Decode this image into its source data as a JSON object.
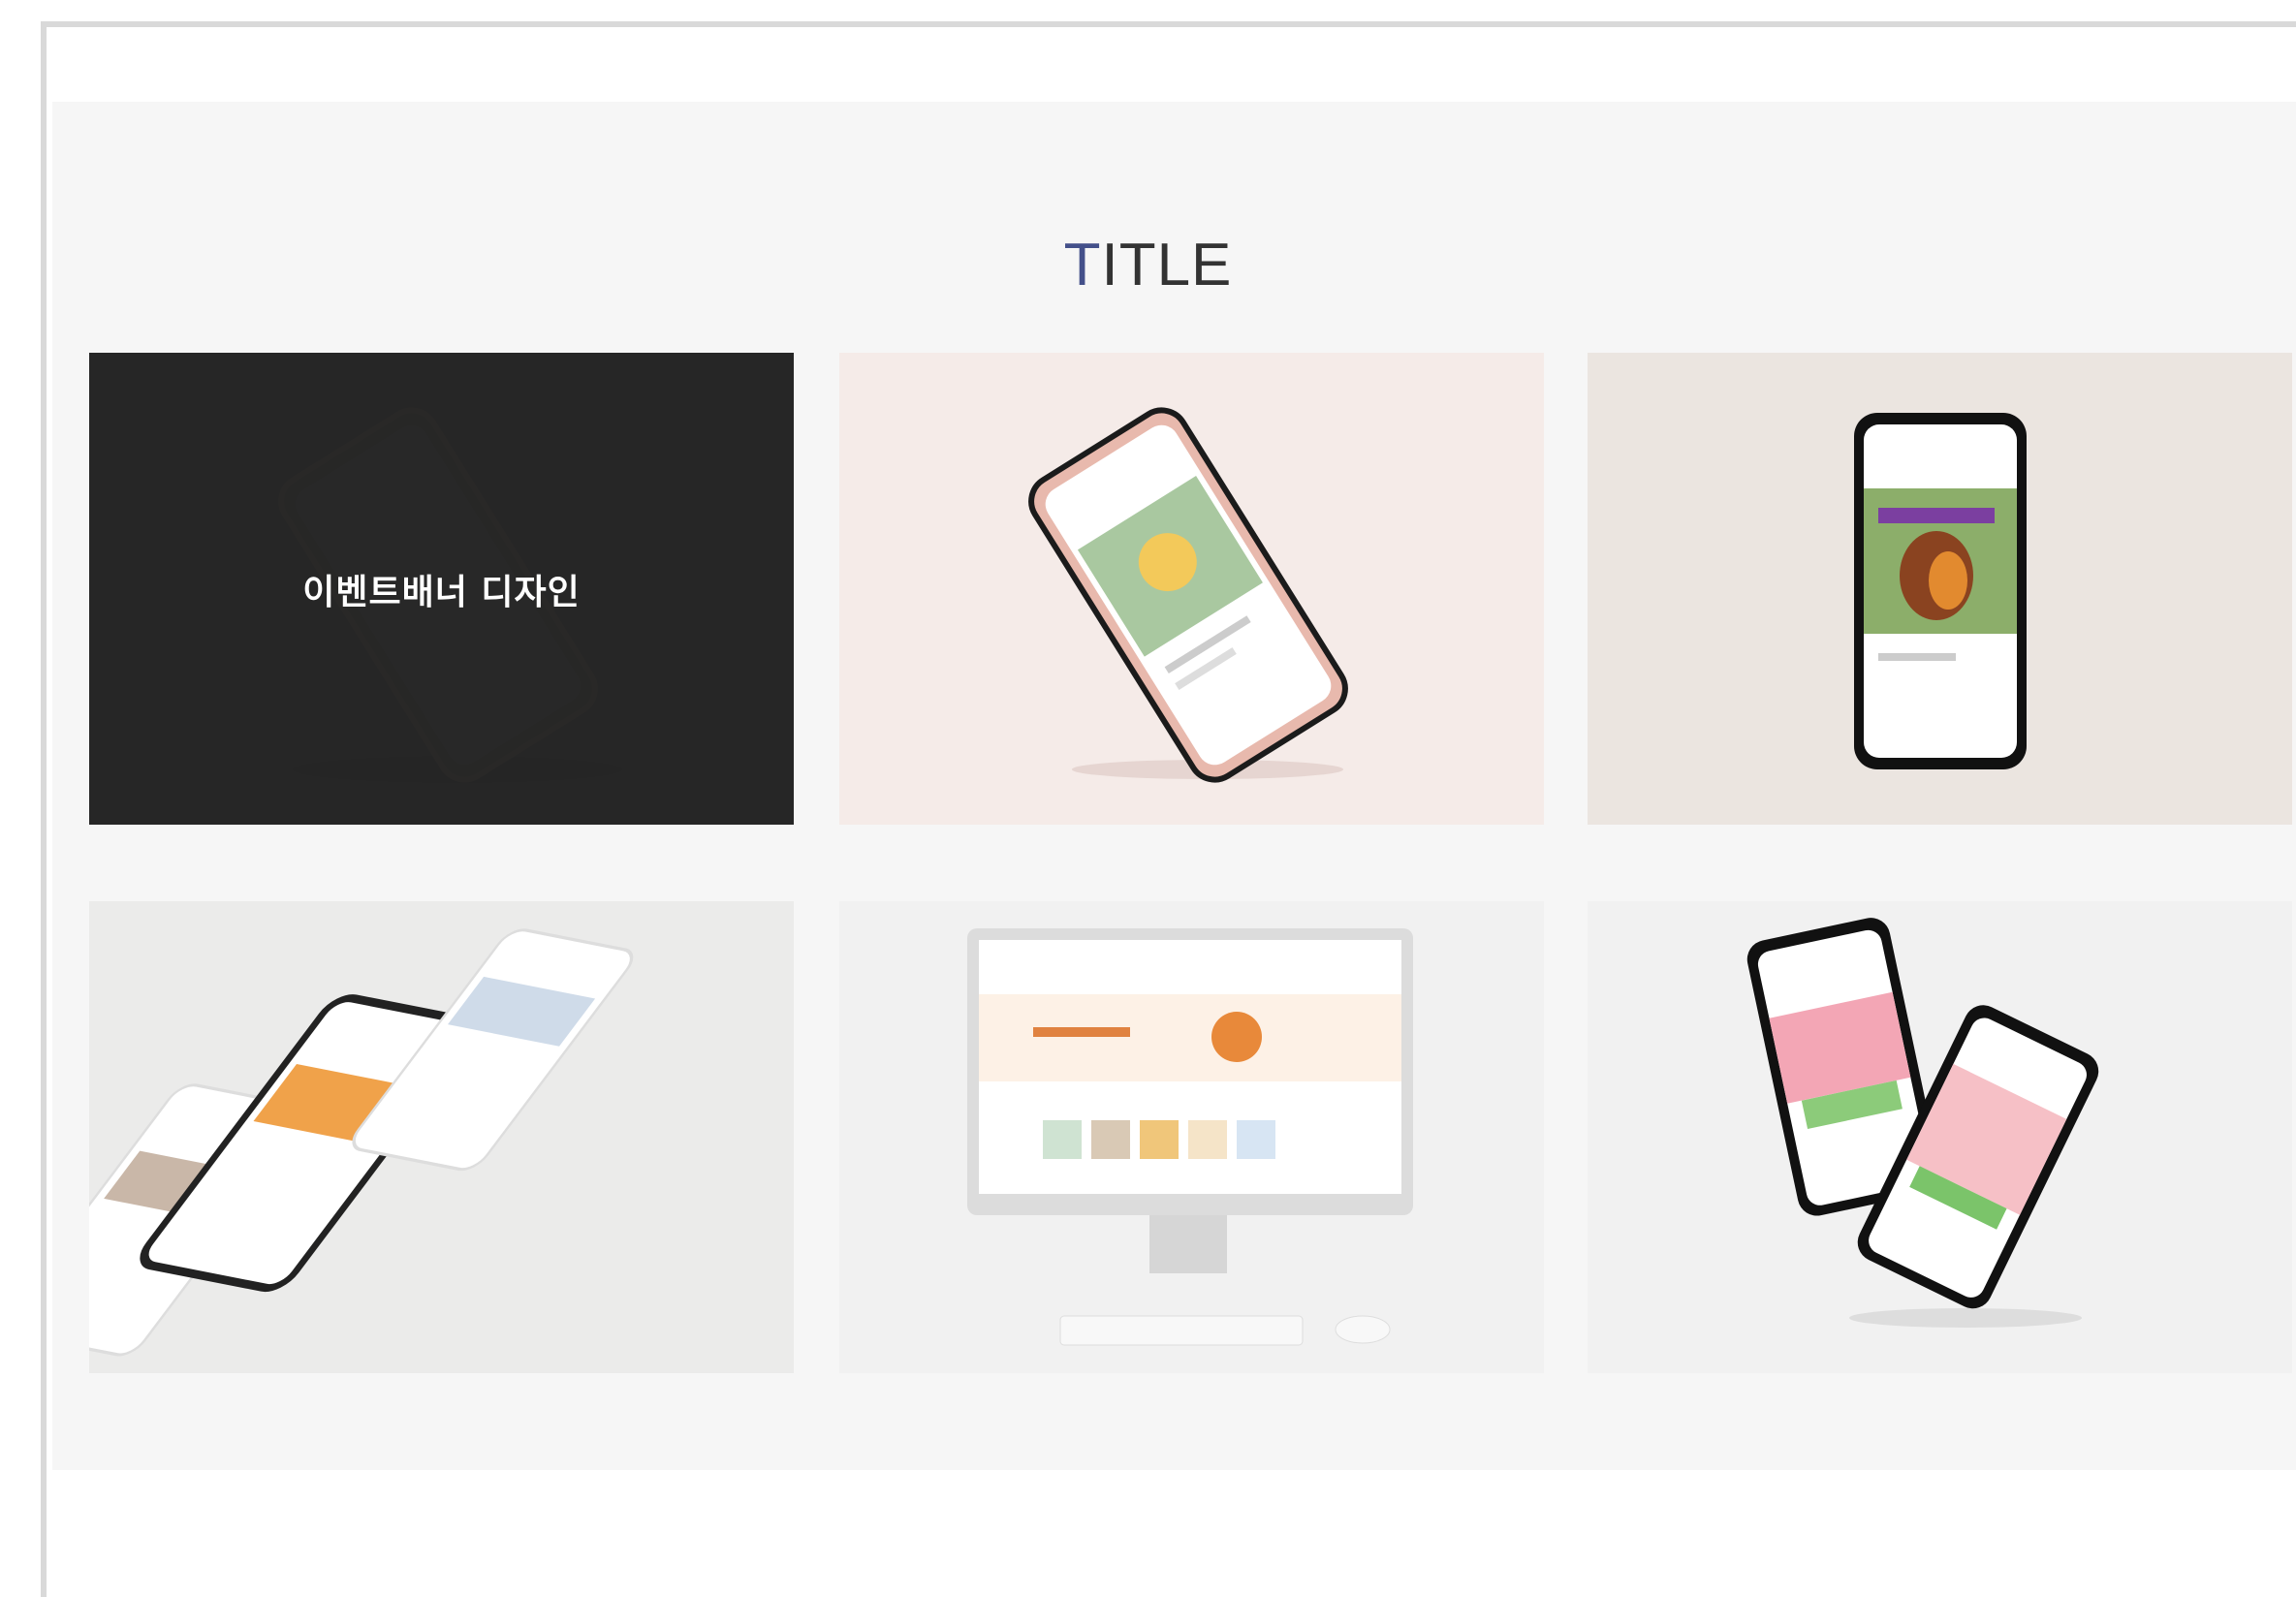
{
  "section": {
    "title_first": "T",
    "title_rest": "ITLE"
  },
  "portfolio": {
    "items": [
      {
        "overlay_label": "이벤트배너 디자인",
        "bg": "#2b2b2b"
      },
      {
        "bg": "#f5ebe8"
      },
      {
        "bg": "#ebe5e0"
      },
      {
        "bg": "#ebebea"
      },
      {
        "bg": "#f1f1f1"
      },
      {
        "bg": "#f1f1f1"
      }
    ]
  },
  "colors": {
    "accent": "#44508a",
    "section_bg": "#f6f6f6",
    "overlay": "#262626"
  }
}
